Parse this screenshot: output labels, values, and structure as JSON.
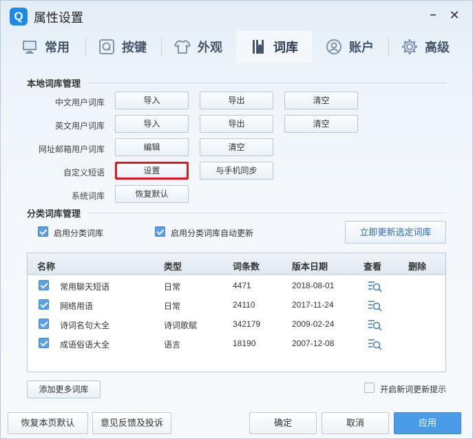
{
  "window": {
    "title": "属性设置",
    "logo_letter": "Q",
    "min_symbol": "–",
    "close_symbol": "✕"
  },
  "tabs": [
    {
      "label": "常用",
      "icon": "monitor-icon"
    },
    {
      "label": "按键",
      "icon": "key-q-icon"
    },
    {
      "label": "外观",
      "icon": "tshirt-icon"
    },
    {
      "label": "词库",
      "icon": "book-icon",
      "active": true
    },
    {
      "label": "账户",
      "icon": "user-icon"
    },
    {
      "label": "高级",
      "icon": "gear-icon"
    }
  ],
  "local": {
    "title": "本地词库管理",
    "rows": {
      "cn_user": {
        "label": "中文用户词库",
        "import": "导入",
        "export": "导出",
        "clear": "清空"
      },
      "en_user": {
        "label": "英文用户词库",
        "import": "导入",
        "export": "导出",
        "clear": "清空"
      },
      "url_email": {
        "label": "网址邮箱用户词库",
        "edit": "编辑",
        "clear": "清空"
      },
      "custom_phrase": {
        "label": "自定义短语",
        "settings": "设置",
        "sync": "与手机同步"
      },
      "system": {
        "label": "系统词库",
        "restore": "恢复默认"
      }
    }
  },
  "category": {
    "title": "分类词库管理",
    "enable_label": "启用分类词库",
    "auto_update_label": "启用分类词库自动更新",
    "update_now": "立即更新选定词库",
    "columns": {
      "name": "名称",
      "type": "类型",
      "count": "词条数",
      "date": "版本日期",
      "view": "查看",
      "delete": "删除"
    },
    "rows": [
      {
        "name": "常用聊天短语",
        "type": "日常",
        "count": "4471",
        "date": "2018-08-01"
      },
      {
        "name": "网络用语",
        "type": "日常",
        "count": "24110",
        "date": "2017-11-24"
      },
      {
        "name": "诗词名句大全",
        "type": "诗词歌赋",
        "count": "342179",
        "date": "2009-02-24"
      },
      {
        "name": "成语俗语大全",
        "type": "语言",
        "count": "18190",
        "date": "2007-12-08"
      }
    ],
    "add_more": "添加更多词库",
    "new_word_prompt": "开启新词更新提示"
  },
  "footer": {
    "restore_page": "恢复本页默认",
    "feedback": "意见反馈及投诉",
    "ok": "确定",
    "cancel": "取消",
    "apply": "应用"
  },
  "colors": {
    "accent": "#4a9be8",
    "highlight_border": "#e5141b",
    "tab_text": "#44546a"
  }
}
